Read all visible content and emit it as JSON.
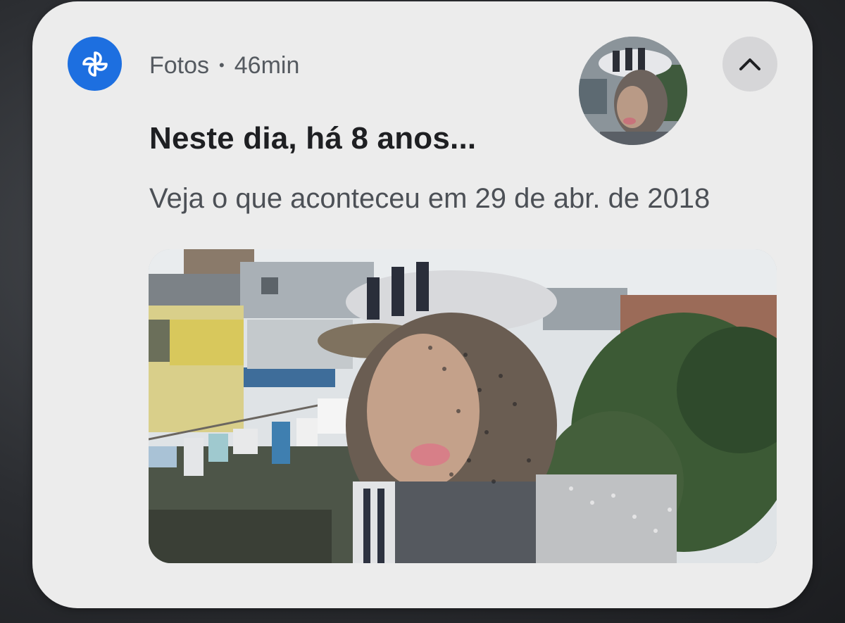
{
  "notification": {
    "app_icon": "pinwheel-icon",
    "app_name": "Fotos",
    "separator": "•",
    "time": "46min",
    "title": "Neste dia, há 8 anos...",
    "subtitle": "Veja o que aconteceu em 29 de abr. de 2018",
    "collapse_icon": "chevron-up-icon",
    "thumbnail": "memory-photo-thumbnail",
    "photo": "memory-photo",
    "colors": {
      "card": "#ececec",
      "app_icon_bg": "#1d6fe0",
      "title": "#1e1f22",
      "secondary_text": "#555a60",
      "collapse_bg": "#d6d6d8"
    }
  }
}
